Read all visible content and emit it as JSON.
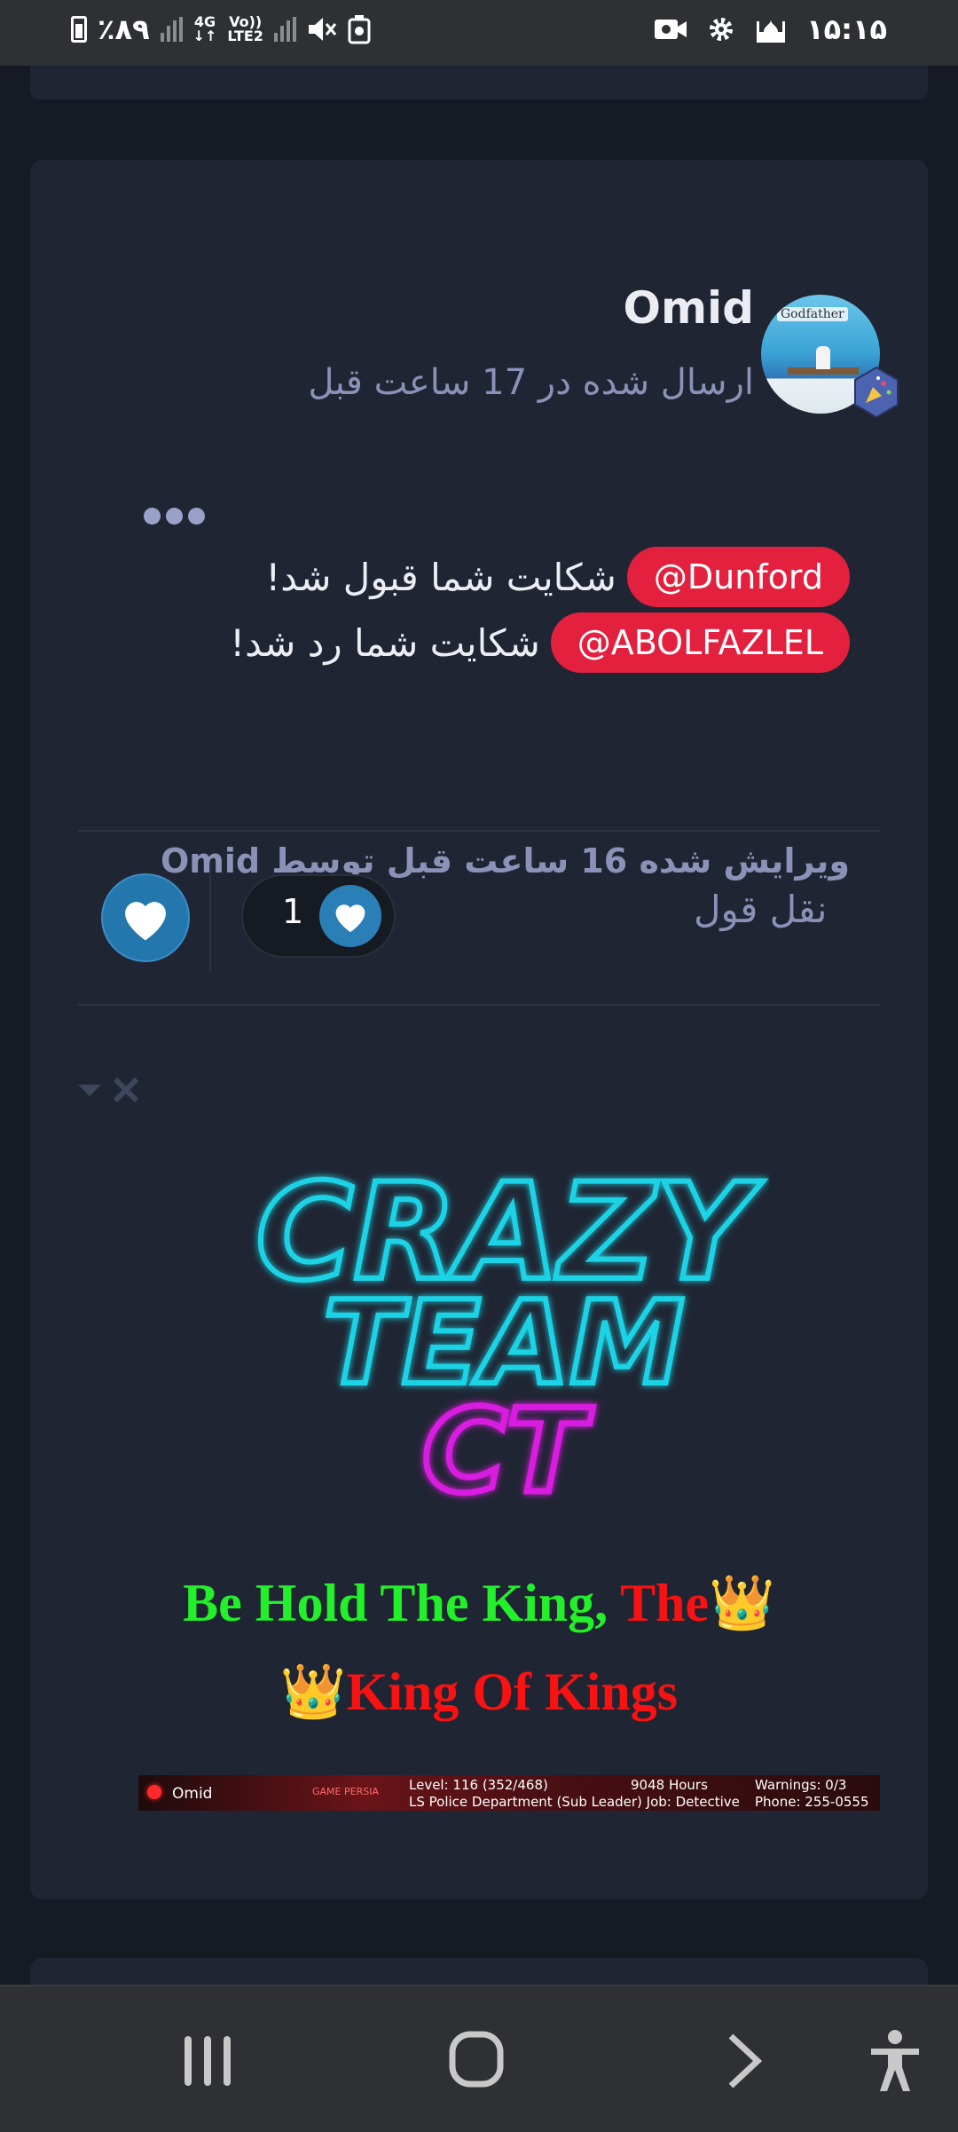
{
  "status_bar": {
    "battery": "٪۸۹",
    "network": "4G",
    "network_arrows": "↓↑",
    "volte_top": "Vo))",
    "volte_bottom": "LTE2",
    "time": "۱۵:۱۵",
    "icons": [
      "battery-icon",
      "signal-icon",
      "mute-icon",
      "recorder-icon",
      "video-icon",
      "settings-icon",
      "mosque-icon"
    ]
  },
  "post": {
    "author": "Omid",
    "posted_time": "ارسال شده در 17 ساعت قبل",
    "avatar_text": "Godfather",
    "lines": [
      {
        "mention": "@Dunford",
        "text": "شکایت شما قبول شد!"
      },
      {
        "mention": "@ABOLFAZLEL",
        "text": "شکایت شما رد شد!"
      }
    ],
    "edited": "ویرایش شده 16 ساعت قبل توسط Omid",
    "quote_label": "نقل قول",
    "reaction_count": "1"
  },
  "signature": {
    "logo_lines": [
      "CRAZY",
      "TEAM",
      "CT"
    ],
    "line1_green": "Be Hold The King, ",
    "line1_red": "The",
    "line2_red": "King Of Kings",
    "crown": "👑",
    "banner": {
      "name": "Omid",
      "level": "Level: 116 (352/468)",
      "hours": "9048 Hours",
      "warnings": "Warnings: 0/3",
      "faction": "LS Police Department (Sub Leader) Job: Detective",
      "phone": "Phone: 255-0555",
      "logo_text": "GAME PERSIA"
    }
  },
  "colors": {
    "background": "#151a24",
    "card": "#202533",
    "mention": "#e3203e",
    "muted": "#8b91b7",
    "like": "#2477ad",
    "green": "#22f02a",
    "red": "#f81212"
  }
}
